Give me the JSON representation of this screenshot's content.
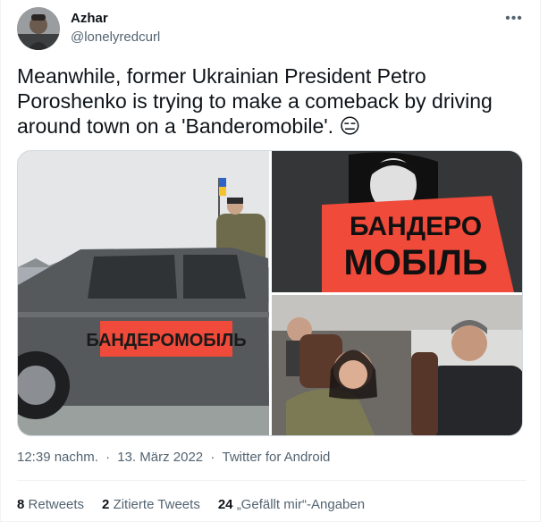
{
  "user": {
    "name": "Azhar",
    "handle": "@lonelyredcurl"
  },
  "tweet": {
    "text": "Meanwhile, former Ukrainian President Petro Poroshenko is trying to make a comeback by driving around town on a 'Banderomobile'.",
    "emoji": "😑"
  },
  "media": {
    "image1": {
      "sign_text": "БАНДЕРОМОБІЛЬ"
    },
    "image2": {
      "line1": "БАНДЕРО",
      "line2": "МОБІЛЬ"
    }
  },
  "meta": {
    "time": "12:39 nachm.",
    "separator1": "·",
    "date": "13. März 2022",
    "separator2": "·",
    "client": "Twitter for Android"
  },
  "stats": {
    "retweets_count": "8",
    "retweets_label": "Retweets",
    "quotes_count": "2",
    "quotes_label": "Zitierte Tweets",
    "likes_count": "24",
    "likes_label": "„Gefällt mir“-Angaben"
  },
  "icons": {
    "more": "more-horizontal-icon"
  },
  "colors": {
    "text": "#0f1419",
    "secondary": "#536471",
    "sign_red": "#f04a3a"
  }
}
